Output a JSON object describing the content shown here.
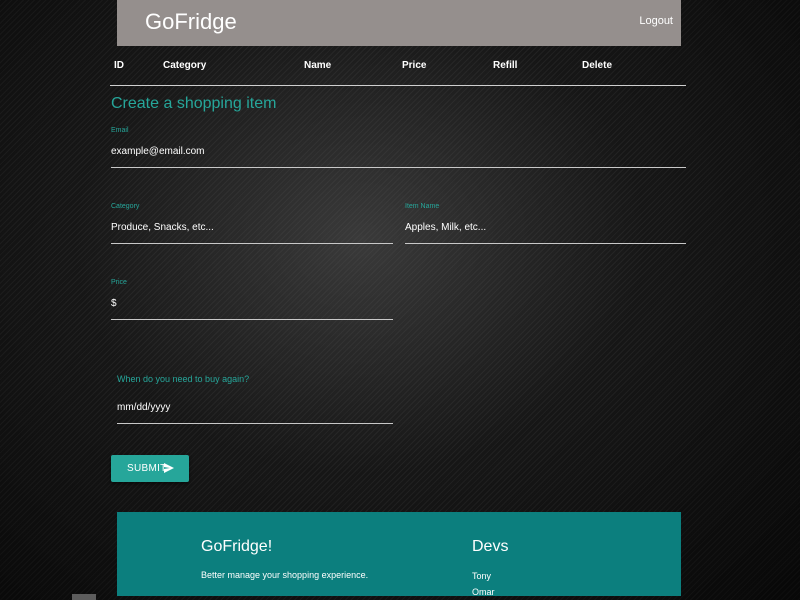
{
  "navbar": {
    "brand": "GoFridge",
    "logout": "Logout"
  },
  "table": {
    "headers": [
      "ID",
      "Category",
      "Name",
      "Price",
      "Refill",
      "Delete"
    ]
  },
  "form": {
    "title": "Create a shopping item",
    "email": {
      "label": "Email",
      "placeholder": "example@email.com"
    },
    "category": {
      "label": "Category",
      "placeholder": "Produce, Snacks, etc..."
    },
    "item_name": {
      "label": "Item Name",
      "placeholder": "Apples, Milk, etc..."
    },
    "price": {
      "label": "Price",
      "placeholder": "$"
    },
    "date": {
      "label": "When do you need to buy again?",
      "placeholder": "mm/dd/yyyy"
    },
    "submit": {
      "label": "SUBMIT",
      "icon": "send-icon"
    }
  },
  "footer": {
    "title": "GoFridge!",
    "text": "Better manage your shopping experience.",
    "devs_title": "Devs",
    "devs": [
      "Tony",
      "Omar"
    ]
  },
  "colors": {
    "navbar": "#958f8d",
    "accent": "#26a69a",
    "footer": "#0c7f7e"
  }
}
